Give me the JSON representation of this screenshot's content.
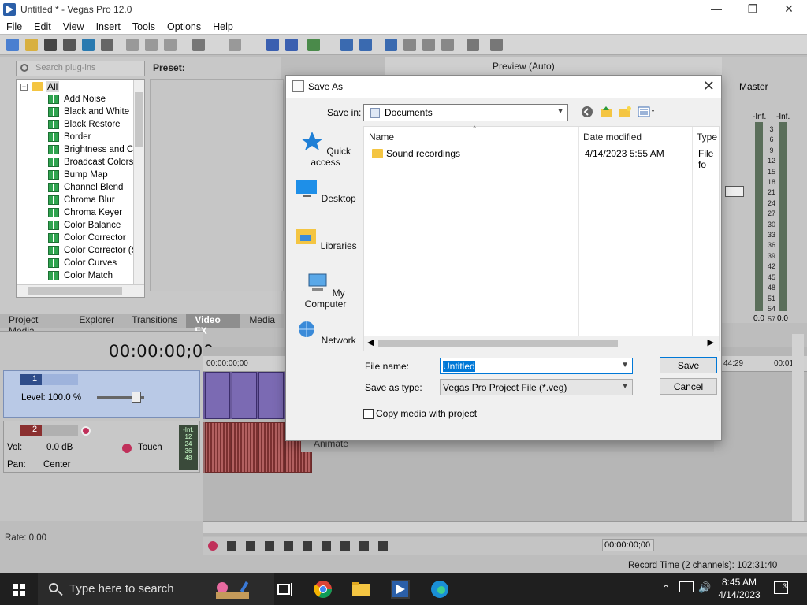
{
  "window": {
    "title": "Untitled * - Vegas Pro 12.0",
    "minimize": "—",
    "maximize": "❐",
    "close": "✕"
  },
  "menu": [
    "File",
    "Edit",
    "View",
    "Insert",
    "Tools",
    "Options",
    "Help"
  ],
  "plugins": {
    "search_placeholder": "Search plug-ins",
    "root_label": "All",
    "root_expander": "−",
    "items": [
      "Add Noise",
      "Black and White",
      "Black Restore",
      "Border",
      "Brightness and Co",
      "Broadcast Colors",
      "Bump Map",
      "Channel Blend",
      "Chroma Blur",
      "Chroma Keyer",
      "Color Balance",
      "Color Corrector",
      "Color Corrector (S",
      "Color Curves",
      "Color Match",
      "Convolution Kerne"
    ],
    "preset_label": "Preset:"
  },
  "tabs": [
    {
      "label": "Project Media",
      "active": false
    },
    {
      "label": "Explorer",
      "active": false
    },
    {
      "label": "Transitions",
      "active": false
    },
    {
      "label": "Video FX",
      "active": true
    },
    {
      "label": "Media",
      "active": false
    }
  ],
  "preview": {
    "label": "Preview (Auto)"
  },
  "tracks": {
    "timecode": "00:00:00;00",
    "video": {
      "number": "1",
      "level": "Level: 100.0 %"
    },
    "audio": {
      "number": "2",
      "vol_label": "Vol:",
      "vol_value": "0.0 dB",
      "mode": "Touch",
      "pan_label": "Pan:",
      "pan_value": "Center",
      "meter": [
        "-Inf.",
        "12",
        "24",
        "36",
        "48"
      ]
    },
    "rate": "Rate: 0.00"
  },
  "timeline": {
    "ruler_start": "00:00:00;00",
    "ruler_mid": "00:00",
    "ruler_end1": "44:29",
    "ruler_end2": "00:01"
  },
  "transport": {
    "time": "00:00:00;00",
    "record_time": "Record Time (2 channels): 102:31:40"
  },
  "master": {
    "title": "Master",
    "inf_l": "-Inf.",
    "inf_r": "-Inf.",
    "ticks": [
      "3",
      "6",
      "9",
      "12",
      "15",
      "18",
      "21",
      "24",
      "27",
      "30",
      "33",
      "36",
      "39",
      "42",
      "45",
      "48",
      "51",
      "54",
      "57"
    ],
    "val_l": "0.0",
    "val_r": "0.0"
  },
  "dialog": {
    "title": "Save As",
    "save_in_label": "Save in:",
    "save_in_value": "Documents",
    "places": [
      "Quick access",
      "Desktop",
      "Libraries",
      "My Computer",
      "Network"
    ],
    "columns": [
      "Name",
      "Date modified",
      "Type"
    ],
    "rows": [
      {
        "name": "Sound recordings",
        "date": "4/14/2023 5:55 AM",
        "type": "File fo"
      }
    ],
    "file_name_label": "File name:",
    "file_name_value": "Untitled",
    "save_type_label": "Save as type:",
    "save_type_value": "Vegas Pro Project File (*.veg)",
    "save_button": "Save",
    "cancel_button": "Cancel",
    "copy_media_label": "Copy media with project"
  },
  "behind_dialog": {
    "animate_label": "Animate"
  },
  "taskbar": {
    "search_placeholder": "Type here to search",
    "time": "8:45 AM",
    "date": "4/14/2023",
    "notifications": "3"
  }
}
